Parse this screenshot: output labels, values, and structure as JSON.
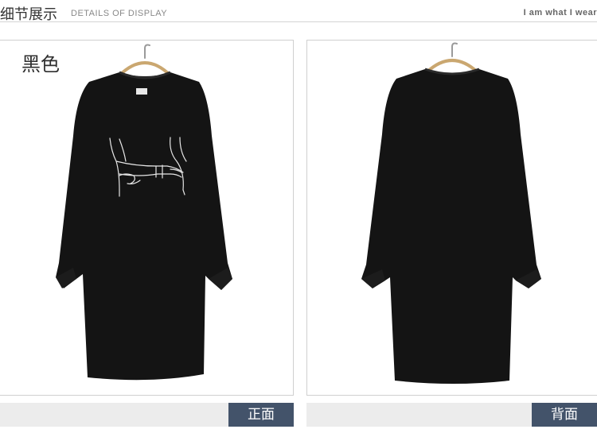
{
  "header": {
    "title": "细节展示",
    "subtitle": "DETAILS OF DISPLAY",
    "slogan": "I am what I wear"
  },
  "panels": [
    {
      "color_label": "黑色",
      "view_tag": "正面"
    },
    {
      "view_tag": "背面"
    }
  ],
  "colors": {
    "garment": "#141414",
    "tag_bg": "#43536a",
    "bar_bg": "#ececec",
    "rule": "#d4d4d4"
  },
  "icons": {
    "hanger": "hanger-icon",
    "print": "hands-line-art-icon"
  }
}
